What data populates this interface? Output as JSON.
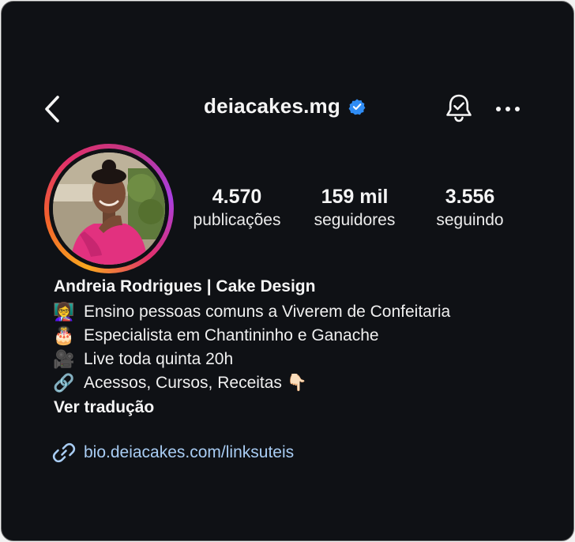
{
  "header": {
    "username": "deiacakes.mg",
    "back_icon": "chevron-left-icon",
    "verified_icon": "verified-badge-icon",
    "bell_icon": "bell-check-icon",
    "more_icon": "more-horizontal-icon"
  },
  "stats": {
    "posts_value": "4.570",
    "posts_label": "publicações",
    "followers_value": "159 mil",
    "followers_label": "seguidores",
    "following_value": "3.556",
    "following_label": "seguindo"
  },
  "profile": {
    "name": "Andreia Rodrigues | Cake Design",
    "bio": [
      {
        "emoji": "👩‍🏫",
        "text": "Ensino pessoas comuns a Viverem de Confeitaria"
      },
      {
        "emoji": "🎂",
        "text": "Especialista em Chantininho e Ganache"
      },
      {
        "emoji": "🎥",
        "text": "Live toda quinta 20h"
      },
      {
        "emoji": "🔗",
        "text": "Acessos, Cursos, Receitas 👇🏻"
      }
    ],
    "translate_label": "Ver tradução",
    "link": "bio.deiacakes.com/linksuteis"
  },
  "colors": {
    "background": "#0f1115",
    "verified": "#2f8cf4",
    "link": "#a9cdf4",
    "ring": [
      "#f9a81f",
      "#e1306c",
      "#c13584"
    ]
  }
}
